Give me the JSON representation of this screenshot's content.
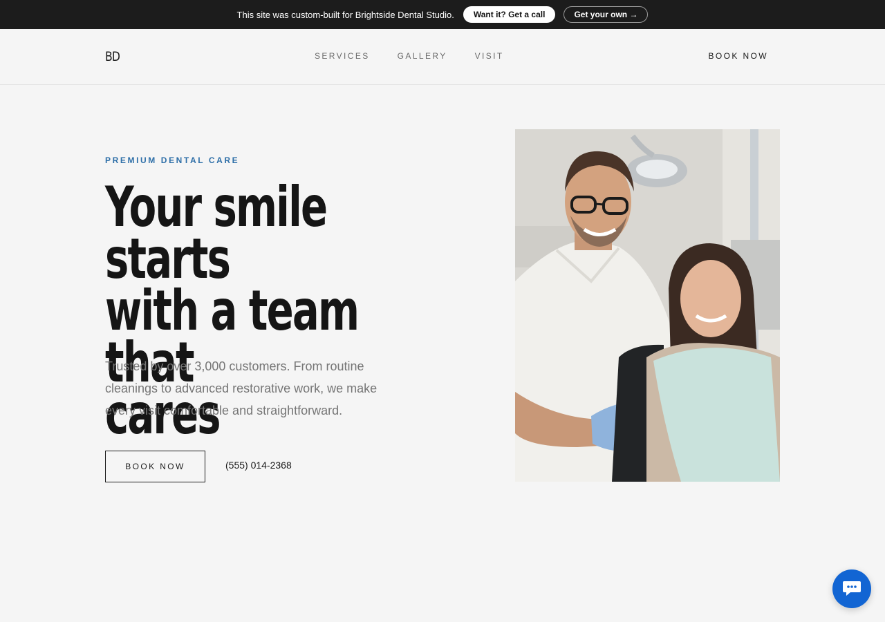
{
  "promo": {
    "text": "This site was custom-built for Brightside Dental Studio.",
    "call_label": "Want it? Get a call",
    "own_label": "Get your own →"
  },
  "nav": {
    "logo": "BD",
    "links": [
      "SERVICES",
      "GALLERY",
      "VISIT"
    ],
    "book_label": "BOOK NOW"
  },
  "hero": {
    "eyebrow": "PREMIUM DENTAL CARE",
    "headline_lines": [
      "Your smile starts",
      "with a team that",
      "cares"
    ],
    "lede": "Trusted by over 3,000 customers. From routine cleanings to advanced restorative work, we make every visit comfortable and straightforward.",
    "cta_label": "BOOK NOW",
    "phone": "(555) 014-2368"
  },
  "colors": {
    "accent": "#2e6fa8",
    "banner_bg": "#1c1c1c",
    "chat_button": "#1265d3"
  },
  "icons": {
    "chat": "chat-bubble-icon"
  }
}
